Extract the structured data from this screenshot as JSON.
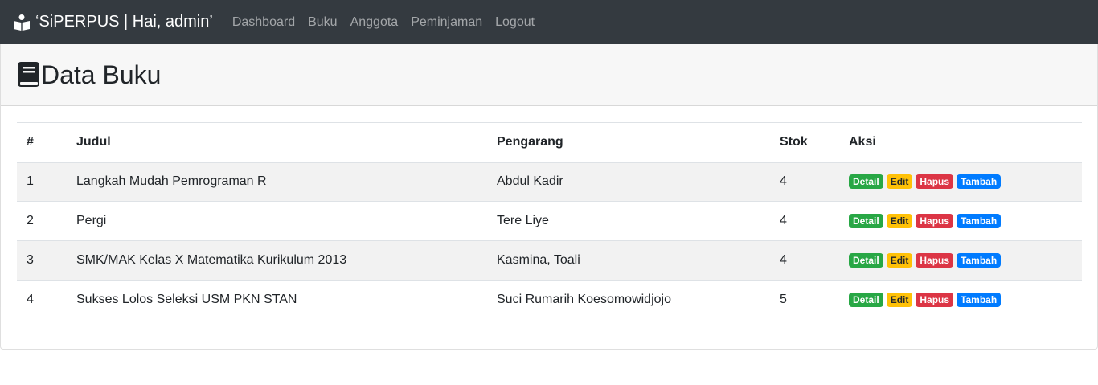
{
  "navbar": {
    "brand": "‘SiPERPUS | Hai, admin’",
    "links": [
      "Dashboard",
      "Buku",
      "Anggota",
      "Peminjaman",
      "Logout"
    ]
  },
  "page": {
    "title": "Data Buku"
  },
  "table": {
    "headers": [
      "#",
      "Judul",
      "Pengarang",
      "Stok",
      "Aksi"
    ],
    "rows": [
      {
        "no": "1",
        "judul": "Langkah Mudah Pemrograman R",
        "pengarang": "Abdul Kadir",
        "stok": "4"
      },
      {
        "no": "2",
        "judul": "Pergi",
        "pengarang": "Tere Liye",
        "stok": "4"
      },
      {
        "no": "3",
        "judul": "SMK/MAK Kelas X Matematika Kurikulum 2013",
        "pengarang": "Kasmina, Toali",
        "stok": "4"
      },
      {
        "no": "4",
        "judul": "Sukses Lolos Seleksi USM PKN STAN",
        "pengarang": "Suci Rumarih Koesomowidjojo",
        "stok": "5"
      }
    ],
    "actions": {
      "detail": "Detail",
      "edit": "Edit",
      "hapus": "Hapus",
      "tambah": "Tambah"
    }
  },
  "colors": {
    "navbar_bg": "#343a40",
    "detail": "#28a745",
    "edit": "#ffc107",
    "hapus": "#dc3545",
    "tambah": "#007bff"
  }
}
